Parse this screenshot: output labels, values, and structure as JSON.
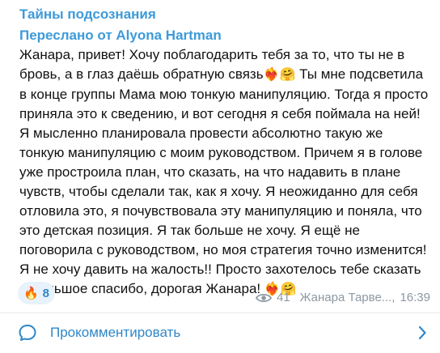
{
  "post": {
    "channel_name": "Тайны подсознания",
    "forwarded_prefix": "Переслано от ",
    "forwarded_from": "Alyona Hartman",
    "message_parts": {
      "p1": "Жанара, привет! Хочу поблагодарить тебя за то, что ты не в бровь, а в глаз даёшь обратную связь",
      "e1": "❤️‍🔥🤗",
      "p2": " Ты мне подсветила в конце группы Мама мою тонкую манипуляцию. Тогда я просто приняла это к сведению, и вот сегодня я себя поймала на ней! Я мысленно планировала провести абсолютно такую же тонкую манипуляцию с моим руководством. Причем я в голове уже простроила план, что сказать, на что надавить в плане чувств, чтобы сделали так, как я хочу. Я неожиданно для себя отловила это, я почувствовала эту манипуляцию и поняла, что это детская позиция. Я так больше не хочу. Я ещё не поговорила с руководством, но моя стратегия точно изменится! Я не хочу давить на жалость!! Просто захотелось тебе сказать – большое спасибо, дорогая Жанара! ",
      "e2": "❤️‍🔥🤗"
    },
    "reaction": {
      "emoji": "🔥",
      "count": "8"
    },
    "views": "41",
    "author": "Жанара Тарве...,",
    "time": "16:39"
  },
  "comments_button": {
    "label": "Прокомментировать"
  },
  "icons": {
    "eye": "eye-icon",
    "comment": "comment-bubble-icon",
    "chevron": "chevron-right-icon"
  },
  "colors": {
    "accent": "#3d9ad9",
    "link": "#2f87c8",
    "meta": "#8d98a3",
    "reaction_bg": "#e8f2fb"
  }
}
